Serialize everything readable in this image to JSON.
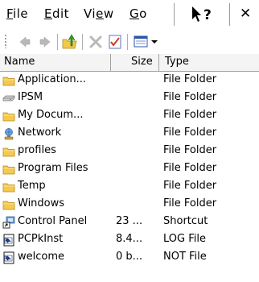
{
  "menu": {
    "file": {
      "u": "F",
      "rest": "ile"
    },
    "edit": {
      "u": "E",
      "rest": "dit"
    },
    "view_pre": "Vi",
    "view": {
      "u": "e",
      "rest": "w"
    },
    "go": {
      "u": "G",
      "rest": "o"
    },
    "close": "✕"
  },
  "toolbar": {
    "icons": [
      "back-arrow-icon",
      "forward-arrow-icon",
      "up-folder-icon",
      "delete-icon",
      "properties-icon",
      "views-icon"
    ]
  },
  "columns": {
    "name": "Name",
    "size": "Size",
    "type": "Type"
  },
  "files": [
    {
      "icon": "folder-icon",
      "name": "Application...",
      "size": "",
      "type": "File Folder"
    },
    {
      "icon": "drive-icon",
      "name": "IPSM",
      "size": "",
      "type": "File Folder"
    },
    {
      "icon": "folder-icon",
      "name": "My Docum...",
      "size": "",
      "type": "File Folder"
    },
    {
      "icon": "network-icon",
      "name": "Network",
      "size": "",
      "type": "File Folder"
    },
    {
      "icon": "folder-icon",
      "name": "profiles",
      "size": "",
      "type": "File Folder"
    },
    {
      "icon": "folder-icon",
      "name": "Program Files",
      "size": "",
      "type": "File Folder"
    },
    {
      "icon": "folder-icon",
      "name": "Temp",
      "size": "",
      "type": "File Folder"
    },
    {
      "icon": "folder-icon",
      "name": "Windows",
      "size": "",
      "type": "File Folder"
    },
    {
      "icon": "shortcut-icon",
      "name": "Control Panel",
      "size": "23 ...",
      "type": "Shortcut"
    },
    {
      "icon": "document-icon",
      "name": "PCPkInst",
      "size": "8.4...",
      "type": "LOG File"
    },
    {
      "icon": "document-icon",
      "name": "welcome",
      "size": "0 b...",
      "type": "NOT File"
    }
  ]
}
